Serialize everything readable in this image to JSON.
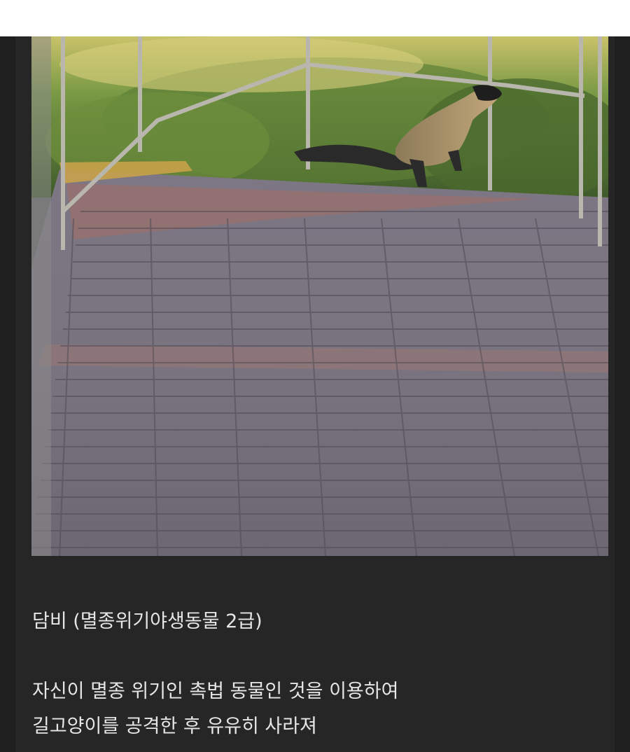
{
  "post": {
    "image_subject": "yellow-throated-marten-on-paved-path",
    "title": "담비 (멸종위기야생동물 2급)",
    "body_lines": [
      "자신이 멸종 위기인 촉법 동물인 것을 이용하여",
      "길고양이를 공격한 후 유유히 사라져"
    ]
  },
  "colors": {
    "background": "#262626",
    "text": "#e6e6e6"
  }
}
